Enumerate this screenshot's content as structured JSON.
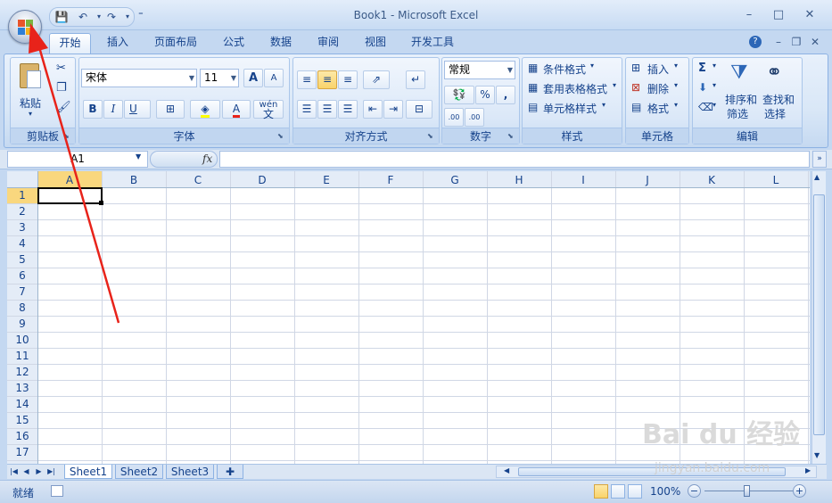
{
  "window": {
    "title": "Book1 - Microsoft Excel",
    "minimize": "–",
    "maximize": "□",
    "close": "✕"
  },
  "qat": {
    "save": "💾",
    "undo": "↶",
    "redo": "↷",
    "more": "⁼"
  },
  "tabs": [
    {
      "label": "开始",
      "active": true
    },
    {
      "label": "插入"
    },
    {
      "label": "页面布局"
    },
    {
      "label": "公式"
    },
    {
      "label": "数据"
    },
    {
      "label": "审阅"
    },
    {
      "label": "视图"
    },
    {
      "label": "开发工具"
    }
  ],
  "ribbon_controls": {
    "help": "?",
    "minimize": "–",
    "restore": "❐",
    "close": "✕"
  },
  "clipboard": {
    "label": "剪贴板",
    "paste": "粘贴",
    "paste_arrow": "▾"
  },
  "font": {
    "label": "字体",
    "name": "宋体",
    "size": "11",
    "grow": "A",
    "shrink": "A",
    "bold": "B",
    "italic": "I",
    "underline": "U",
    "fontcolor": "A",
    "phonetic": "wén"
  },
  "alignment": {
    "label": "对齐方式"
  },
  "number": {
    "label": "数字",
    "format": "常规",
    "percent": "%",
    "comma": ",",
    "inc_decimal": ".00",
    "dec_decimal": ".00"
  },
  "styles": {
    "label": "样式",
    "conditional": "条件格式",
    "table": "套用表格格式",
    "cell": "单元格样式"
  },
  "cells": {
    "label": "单元格",
    "insert": "插入",
    "delete": "删除",
    "format": "格式"
  },
  "editing": {
    "label": "编辑",
    "sum": "Σ",
    "sort_line1": "排序和",
    "sort_line2": "筛选",
    "find_line1": "查找和",
    "find_line2": "选择"
  },
  "formula_bar": {
    "name_box": "A1",
    "fx": "fx",
    "expand": "»"
  },
  "grid": {
    "columns": [
      "A",
      "B",
      "C",
      "D",
      "E",
      "F",
      "G",
      "H",
      "I",
      "J",
      "K",
      "L"
    ],
    "rows": [
      "1",
      "2",
      "3",
      "4",
      "5",
      "6",
      "7",
      "8",
      "9",
      "10",
      "11",
      "12",
      "13",
      "14",
      "15",
      "16",
      "17"
    ],
    "selected_cell": "A1"
  },
  "sheets": [
    {
      "label": "Sheet1",
      "active": true
    },
    {
      "label": "Sheet2"
    },
    {
      "label": "Sheet3"
    }
  ],
  "status": {
    "ready": "就绪",
    "zoom": "100%",
    "minus": "−",
    "plus": "+"
  },
  "watermark": {
    "main": "Bai du 经验",
    "sub": "jingyan.baidu.com"
  },
  "colors": {
    "accent": "#15428b",
    "ribbon_bg": "#dbe8f8",
    "selected_header": "#f9d77e",
    "annotation_red": "#e8231a"
  }
}
